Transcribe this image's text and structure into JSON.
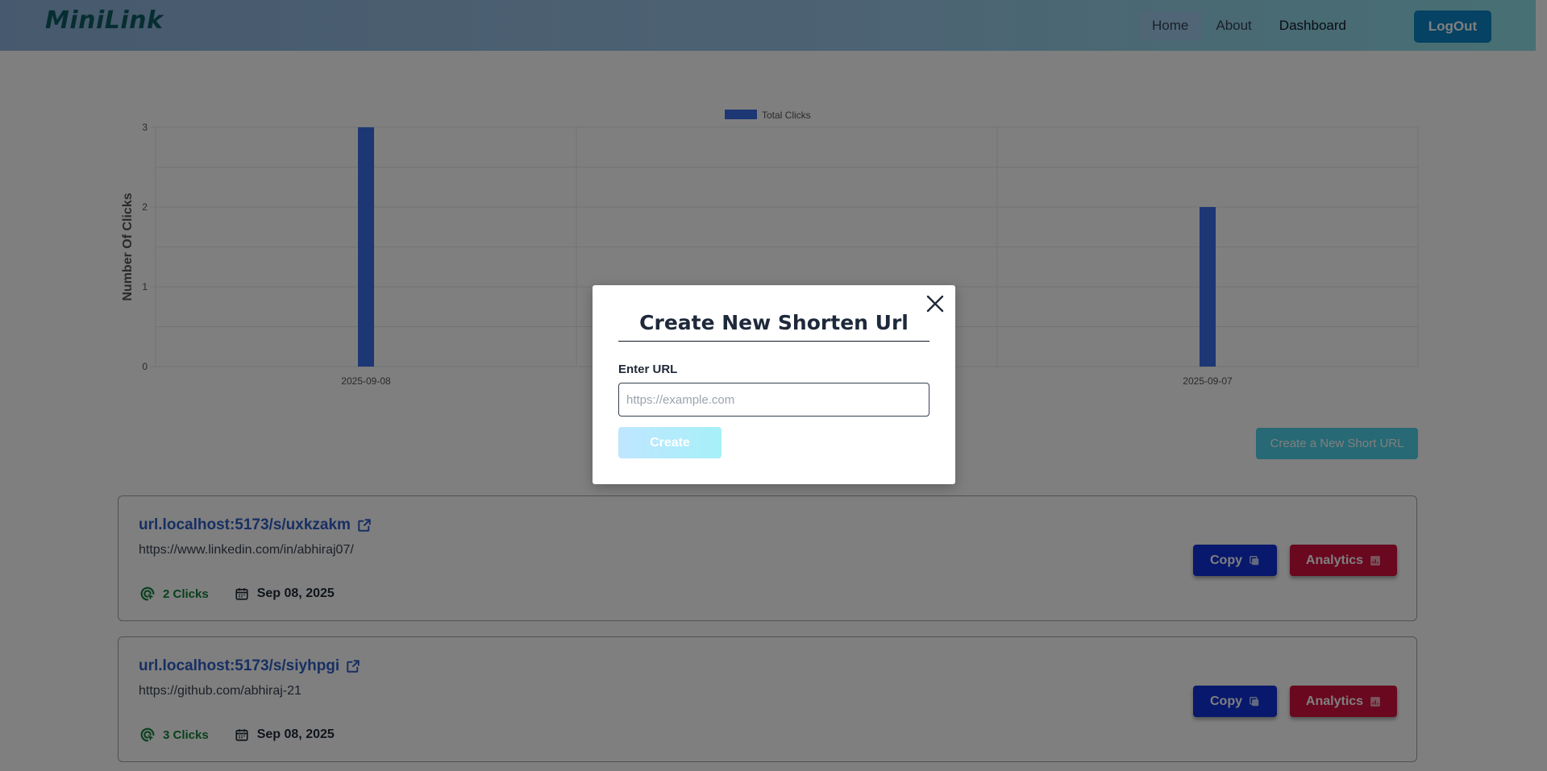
{
  "navbar": {
    "brand": "MiniLink",
    "links": [
      "Home",
      "About",
      "Dashboard"
    ],
    "logout_label": "LogOut"
  },
  "chart_data": {
    "type": "bar",
    "categories": [
      "2025-09-08",
      "",
      "2025-09-07"
    ],
    "series": [
      {
        "name": "Total Clicks",
        "values": [
          3,
          0,
          2
        ],
        "color": "#3b6fe8"
      }
    ],
    "ylabel": "Number Of Clicks",
    "xlabel": "",
    "ylim": [
      0,
      3
    ],
    "yticks": [
      "0",
      "1",
      "2",
      "3"
    ],
    "grid": true,
    "legend": "top-center"
  },
  "create_button_label": "Create a New Short URL",
  "urls": [
    {
      "short": "url.localhost:5173/s/uxkzakm",
      "original": "https://www.linkedin.com/in/abhiraj07/",
      "clicks": "2 Clicks",
      "date": "Sep 08, 2025",
      "copy_label": "Copy",
      "analytics_label": "Analytics"
    },
    {
      "short": "url.localhost:5173/s/siyhpgi",
      "original": "https://github.com/abhiraj-21",
      "clicks": "3 Clicks",
      "date": "Sep 08, 2025",
      "copy_label": "Copy",
      "analytics_label": "Analytics"
    }
  ],
  "modal": {
    "title": "Create New Shorten Url",
    "field_label": "Enter URL",
    "input_placeholder": "https://example.com",
    "input_value": "",
    "create_label": "Create",
    "close_icon": "close-icon"
  },
  "colors": {
    "accent": "#0a84c6",
    "brand": "#0d5c63",
    "link": "#2f5ec7",
    "bar": "#3b6fe8",
    "copy": "#1030d8",
    "analytics": "#d3103f",
    "clicks": "#15803d"
  }
}
